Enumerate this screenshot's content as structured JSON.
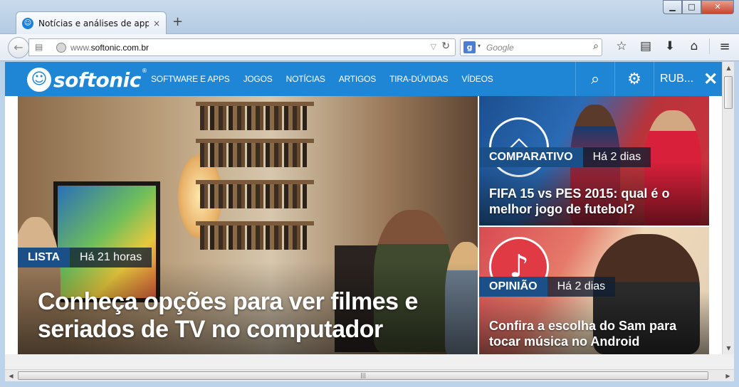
{
  "window": {
    "tab_title": "Notícias e análises de app, ...",
    "tab_close": "×",
    "new_tab": "+",
    "minimize": "▁",
    "maximize": "□",
    "close": "✕"
  },
  "navbar": {
    "back": "←",
    "url_host_prefix": "www.",
    "url_host": "softonic.com.br",
    "url_dropdown": "▽",
    "reload": "↻",
    "search_engine_letter": "g",
    "search_dropdown": "▾",
    "search_placeholder": "Google",
    "search_glyph": "⌕",
    "bookmark_star": "☆",
    "bookmarks_list": "▤",
    "downloads": "⬇",
    "home": "⌂",
    "menu": "≡"
  },
  "site": {
    "logo_mark": "☺",
    "logo_text": "softonic",
    "logo_reg": "®",
    "nav": [
      "SOFTWARE E APPS",
      "JOGOS",
      "NOTÍCIAS",
      "ARTIGOS",
      "TIRA-DÚVIDAS",
      "VÍDEOS"
    ],
    "search_glyph": "⌕",
    "settings_glyph": "⚙",
    "user_label": "RUB...",
    "user_close": "✕"
  },
  "hero": {
    "tag": "LISTA",
    "time": "Há 21 horas",
    "headline": "Conheça opções para ver filmes e seriados de TV no computador"
  },
  "cards": [
    {
      "tag": "COMPARATIVO",
      "time": "Há 2 dias",
      "title": "FIFA 15 vs PES 2015: qual é o melhor jogo de futebol?",
      "emblem": "◇"
    },
    {
      "tag": "OPINIÃO",
      "time": "Há 2 dias",
      "title": "Confira a escolha do Sam para tocar música no Android",
      "emblem": "♪"
    }
  ],
  "scrollbars": {
    "up": "▲",
    "down": "▼",
    "left": "◀",
    "right": "▶",
    "grip": "|||"
  }
}
